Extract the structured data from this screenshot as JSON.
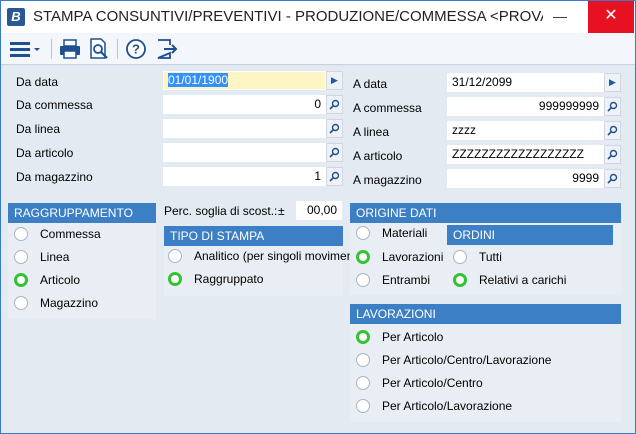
{
  "window": {
    "title": "STAMPA CONSUNTIVI/PREVENTIVI - PRODUZIONE/COMMESSA <PROVA ...",
    "logo_letter": "B",
    "minimize_label": "—",
    "close_label": "✕"
  },
  "toolbar": {
    "items": [
      "menu-icon",
      "print-icon",
      "print-preview-icon",
      "help-icon",
      "exit-icon"
    ]
  },
  "filters": {
    "da_data": {
      "label": "Da data",
      "value": "01/01/1900"
    },
    "da_commessa": {
      "label": "Da commessa",
      "value": "0"
    },
    "da_linea": {
      "label": "Da linea",
      "value": ""
    },
    "da_articolo": {
      "label": "Da articolo",
      "value": ""
    },
    "da_magazzino": {
      "label": "Da magazzino",
      "value": "1"
    },
    "a_data": {
      "label": "A data",
      "value": "31/12/2099"
    },
    "a_commessa": {
      "label": "A commessa",
      "value": "999999999"
    },
    "a_linea": {
      "label": "A linea",
      "value": "zzzz"
    },
    "a_articolo": {
      "label": "A articolo",
      "value": "ZZZZZZZZZZZZZZZZZZ"
    },
    "a_magazzino": {
      "label": "A magazzino",
      "value": "9999"
    }
  },
  "raggruppamento": {
    "title": "RAGGRUPPAMENTO",
    "options": [
      "Commessa",
      "Linea",
      "Articolo",
      "Magazzino"
    ],
    "selected": "Articolo"
  },
  "soglia": {
    "label": "Perc. soglia di scost.:",
    "sign": "±",
    "value": "00,00"
  },
  "tipo_stampa": {
    "title": "TIPO DI STAMPA",
    "options": [
      "Analitico (per singoli moviment",
      "Raggruppato"
    ],
    "selected": "Raggruppato"
  },
  "origine_dati": {
    "title": "ORIGINE DATI",
    "options": [
      "Materiali",
      "Lavorazioni",
      "Entrambi"
    ],
    "selected": "Lavorazioni"
  },
  "ordini": {
    "title": "ORDINI",
    "options": [
      "Tutti",
      "Relativi a carichi"
    ],
    "selected": "Relativi a carichi"
  },
  "lavorazioni": {
    "title": "LAVORAZIONI",
    "options": [
      "Per Articolo",
      "Per Articolo/Centro/Lavorazione",
      "Per Articolo/Centro",
      "Per Articolo/Lavorazione"
    ],
    "selected": "Per Articolo"
  }
}
